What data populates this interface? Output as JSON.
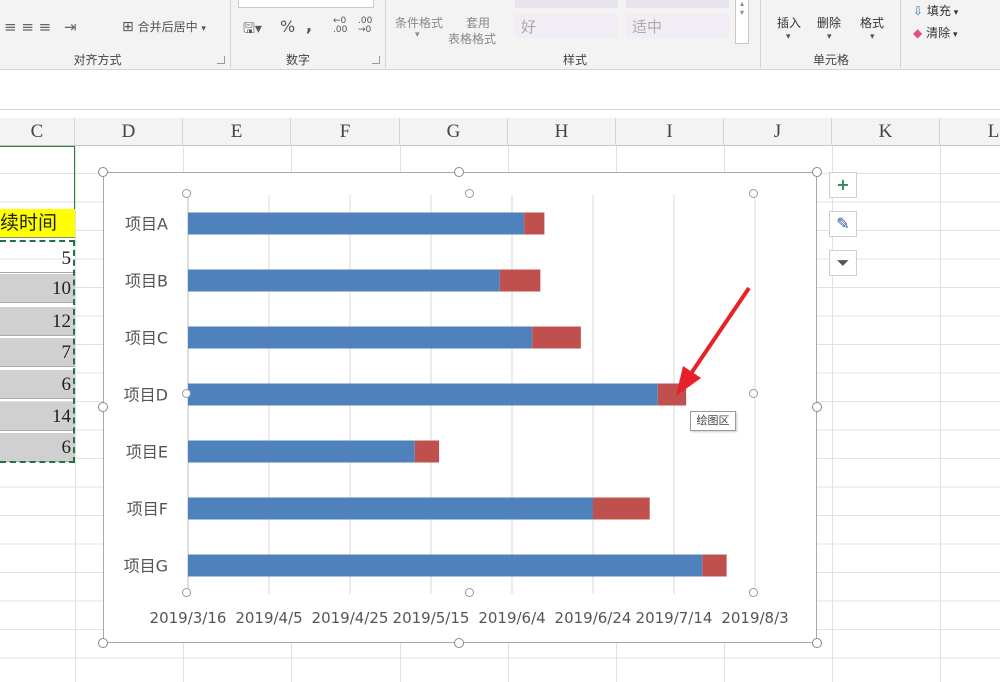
{
  "ribbon": {
    "groups": {
      "alignment": "对齐方式",
      "number": "数字",
      "styles": "样式",
      "cells": "单元格"
    },
    "merge_center": "合并后居中",
    "number_symbols": {
      "percent": "%",
      "comma": ","
    },
    "conditional_format": "条件格式",
    "table_format_1": "套用",
    "table_format_2": "表格格式",
    "style_good": "好",
    "style_neutral": "适中",
    "insert": "插入",
    "delete": "删除",
    "format": "格式",
    "fill": "填充",
    "clear": "清除"
  },
  "columns": [
    "C",
    "D",
    "E",
    "F",
    "G",
    "H",
    "I",
    "J",
    "K",
    "L"
  ],
  "column_c": {
    "header_fragment": "续时间",
    "values": [
      "5",
      "10",
      "12",
      "7",
      "6",
      "14",
      "6"
    ]
  },
  "colors": {
    "blue_series": "#4f81bd",
    "red_series": "#c0504d",
    "header_yellow": "#ffff00",
    "arrow": "#e8202a"
  },
  "chart_data": {
    "type": "bar",
    "orientation": "horizontal-stacked",
    "categories": [
      "项目A",
      "项目B",
      "项目C",
      "项目D",
      "项目E",
      "项目F",
      "项目G"
    ],
    "series": [
      {
        "values": [
          83,
          77,
          85,
          116,
          56,
          100,
          127
        ]
      },
      {
        "values": [
          5,
          10,
          12,
          7,
          6,
          14,
          6
        ]
      }
    ],
    "x_tick_labels": [
      "2019/3/16",
      "2019/4/5",
      "2019/4/25",
      "2019/5/15",
      "2019/6/4",
      "2019/6/24",
      "2019/7/14",
      "2019/8/3"
    ],
    "xlim": [
      0,
      140
    ],
    "x_tick_step": 20,
    "grid": true
  },
  "tooltip": "绘图区",
  "side_buttons": [
    "chart-elements-icon",
    "chart-styles-icon",
    "chart-filter-icon"
  ]
}
